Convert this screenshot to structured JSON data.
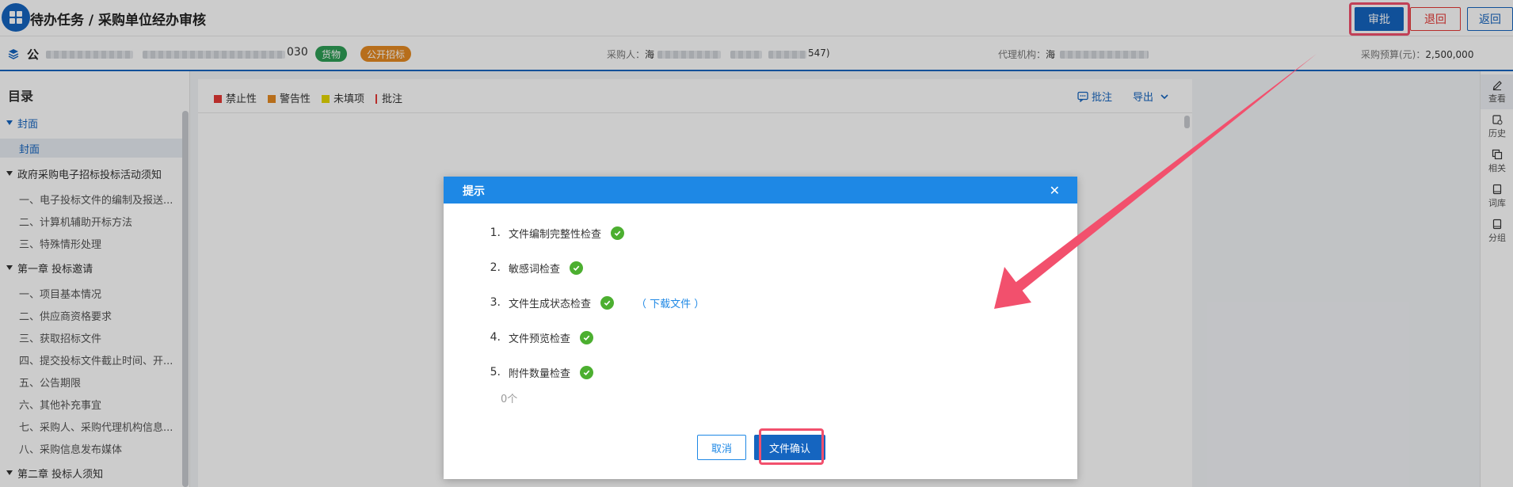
{
  "header": {
    "title": "待办任务 / 采购单位经办审核",
    "approve_label": "审批",
    "reject_label": "退回",
    "back_label": "返回"
  },
  "info": {
    "project_prefix": "公",
    "project_suffix": "030",
    "tag_goods": "货物",
    "tag_method": "公开招标",
    "purchaser_label": "采购人：",
    "purchaser_prefix": "海",
    "purchaser_suffix": "547)",
    "agency_label": "代理机构：",
    "agency_prefix": "海",
    "budget_label": "采购预算(元)：",
    "budget_value": "2,500,000"
  },
  "sidebar": {
    "title": "目录",
    "items": [
      {
        "label": "封面"
      },
      {
        "label": "封面"
      },
      {
        "label": "政府采购电子招标投标活动须知"
      },
      {
        "label": "一、电子投标文件的编制及报送..."
      },
      {
        "label": "二、计算机辅助开标方法"
      },
      {
        "label": "三、特殊情形处理"
      },
      {
        "label": "第一章 投标邀请"
      },
      {
        "label": "一、项目基本情况"
      },
      {
        "label": "二、供应商资格要求"
      },
      {
        "label": "三、获取招标文件"
      },
      {
        "label": "四、提交投标文件截止时间、开..."
      },
      {
        "label": "五、公告期限"
      },
      {
        "label": "六、其他补充事宜"
      },
      {
        "label": "七、采购人、采购代理机构信息..."
      },
      {
        "label": "八、采购信息发布媒体"
      },
      {
        "label": "第二章 投标人须知"
      }
    ]
  },
  "toolbar": {
    "legend_forbidden": "禁止性",
    "legend_warning": "警告性",
    "legend_unfilled": "未填项",
    "legend_comment": "批注",
    "comment_label": "批注",
    "export_label": "导出"
  },
  "right_panel": {
    "items": [
      {
        "label": "查看"
      },
      {
        "label": "历史"
      },
      {
        "label": "相关"
      },
      {
        "label": "词库"
      },
      {
        "label": "分组"
      }
    ]
  },
  "modal": {
    "title": "提示",
    "checks": [
      {
        "num": "1.",
        "label": "文件编制完整性检查"
      },
      {
        "num": "2.",
        "label": "敏感词检查"
      },
      {
        "num": "3.",
        "label": "文件生成状态检查"
      },
      {
        "num": "4.",
        "label": "文件预览检查"
      },
      {
        "num": "5.",
        "label": "附件数量检查"
      }
    ],
    "download_link": "（ 下载文件 ）",
    "attachment_count": "0个",
    "cancel_label": "取消",
    "confirm_label": "文件确认"
  },
  "colors": {
    "primary": "#1565c0",
    "modal_header": "#1e88e5",
    "success": "#4caf30",
    "highlight": "#f2506d",
    "legend_forbidden": "#e53935",
    "legend_warning": "#e58a22",
    "legend_unfilled": "#e5d800"
  }
}
